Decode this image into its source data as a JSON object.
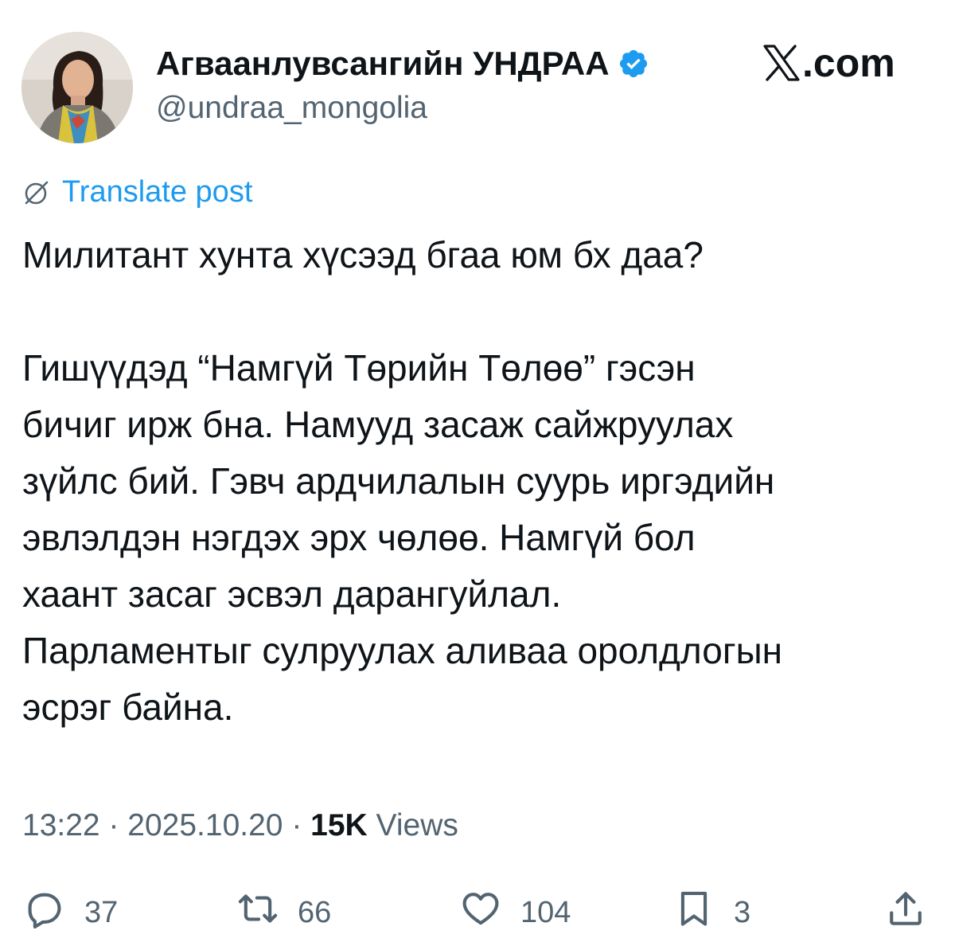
{
  "author": {
    "display_name": "Агваанлувсангийн УНДРАА",
    "handle": "@undraa_mongolia",
    "verified": true,
    "avatar_icon": "profile-photo"
  },
  "brand": {
    "label": ".com",
    "icon": "x-logo"
  },
  "translate": {
    "label": "Translate post",
    "icon": "globe-icon"
  },
  "post": {
    "paragraph_1": "Милитант хунта хүсээд бгаа юм бх даа?",
    "paragraph_2": "Гишүүдэд “Намгүй Төрийн Төлөө” гэсэн\nбичиг ирж бна. Намууд засаж сайжруулах\nзүйлс бий. Гэвч ардчилалын суурь иргэдийн\nэвлэлдэн нэгдэх эрх чөлөө. Намгүй бол\nхаант засаг эсвэл дарангуйлал.\nПарламентыг сулруулах аливаа оролдлогын\nэсрэг байна."
  },
  "meta": {
    "time": "13:22",
    "separator": " · ",
    "date": "2025.10.20",
    "views_count": "15K",
    "views_label": " Views"
  },
  "actions": {
    "reply_count": "37",
    "repost_count": "66",
    "like_count": "104",
    "bookmark_count": "3"
  },
  "colors": {
    "text": "#0f1419",
    "secondary": "#536471",
    "accent": "#1d9bf0"
  }
}
